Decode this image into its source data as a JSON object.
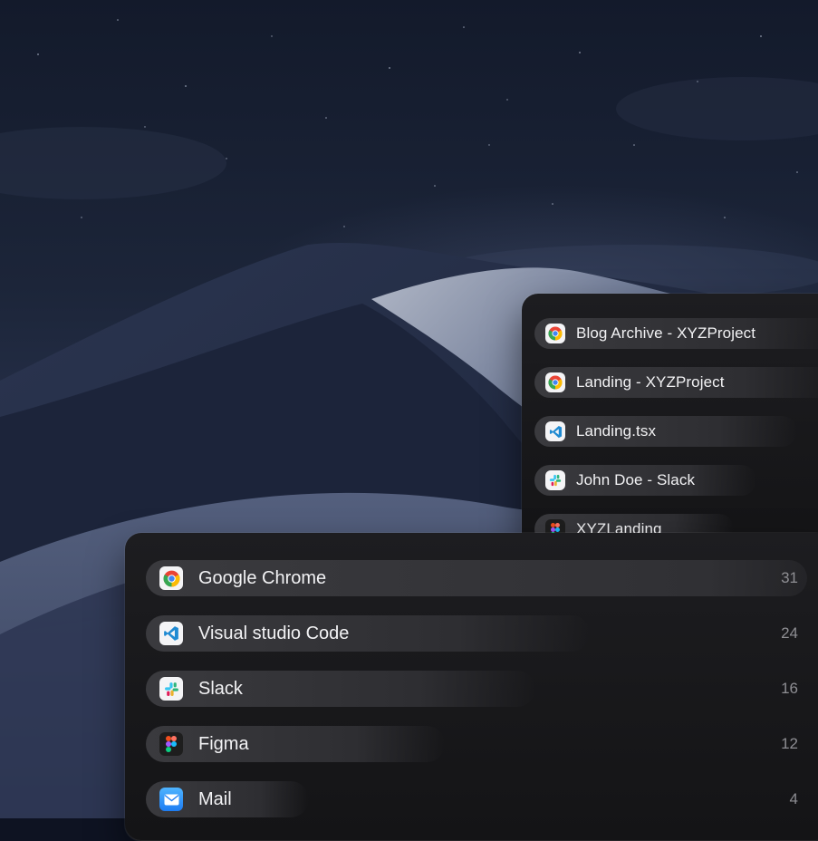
{
  "windows_panel": {
    "items": [
      {
        "label": "Blog Archive - XYZProject",
        "icon": "chrome-icon"
      },
      {
        "label": "Landing - XYZProject",
        "icon": "chrome-icon"
      },
      {
        "label": "Landing.tsx",
        "icon": "vscode-icon"
      },
      {
        "label": "John Doe - Slack",
        "icon": "slack-icon"
      },
      {
        "label": "XYZLanding",
        "icon": "figma-icon"
      }
    ]
  },
  "apps_panel": {
    "items": [
      {
        "label": "Google Chrome",
        "count": "31",
        "icon": "chrome-icon"
      },
      {
        "label": "Visual studio Code",
        "count": "24",
        "icon": "vscode-icon"
      },
      {
        "label": "Slack",
        "count": "16",
        "icon": "slack-icon"
      },
      {
        "label": "Figma",
        "count": "12",
        "icon": "figma-icon"
      },
      {
        "label": "Mail",
        "count": "4",
        "icon": "mail-icon"
      }
    ]
  },
  "colors": {
    "panel_bg": "#1a1a1d",
    "row_bg": "#36363a",
    "count_text": "#8e8e93"
  }
}
